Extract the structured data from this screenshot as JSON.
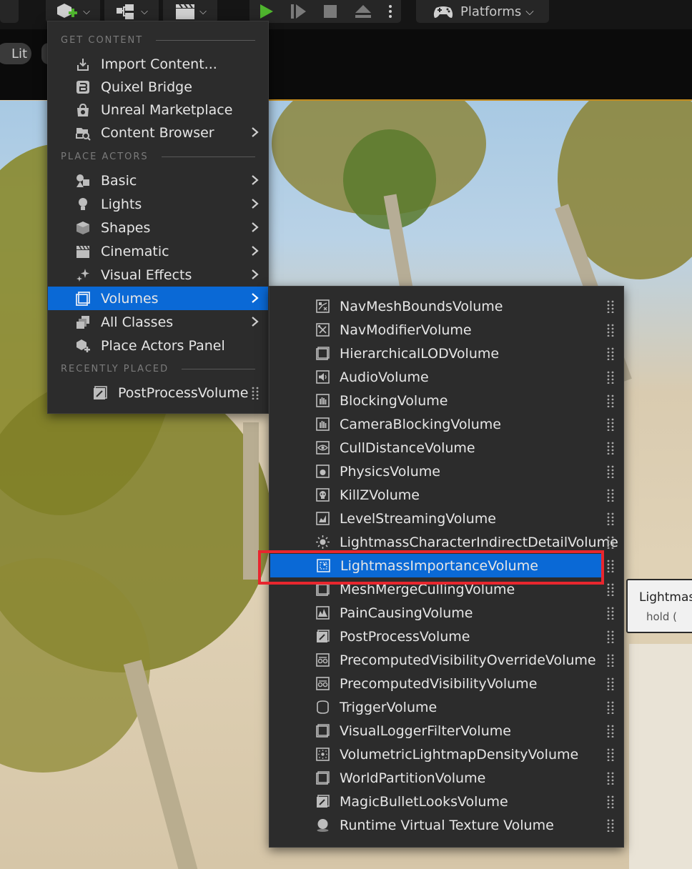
{
  "toolbar": {
    "platforms_label": "Platforms"
  },
  "viewport": {
    "lit_label": "Lit"
  },
  "menu": {
    "sections": {
      "get_content": "GET CONTENT",
      "place_actors": "PLACE ACTORS",
      "recently_placed": "RECENTLY PLACED"
    },
    "get_content_items": [
      {
        "label": "Import Content...",
        "icon": "import-icon",
        "submenu": false
      },
      {
        "label": "Quixel Bridge",
        "icon": "bridge-icon",
        "submenu": false
      },
      {
        "label": "Unreal Marketplace",
        "icon": "marketplace-icon",
        "submenu": false
      },
      {
        "label": "Content Browser",
        "icon": "content-browser-icon",
        "submenu": true
      }
    ],
    "place_actors_items": [
      {
        "label": "Basic",
        "icon": "basic-icon",
        "submenu": true
      },
      {
        "label": "Lights",
        "icon": "lightbulb-icon",
        "submenu": true
      },
      {
        "label": "Shapes",
        "icon": "cube-icon",
        "submenu": true
      },
      {
        "label": "Cinematic",
        "icon": "clapperboard-icon",
        "submenu": true
      },
      {
        "label": "Visual Effects",
        "icon": "sparkles-icon",
        "submenu": true
      },
      {
        "label": "Volumes",
        "icon": "volume-icon",
        "submenu": true,
        "active": true
      },
      {
        "label": "All Classes",
        "icon": "classes-icon",
        "submenu": true
      },
      {
        "label": "Place Actors Panel",
        "icon": "place-actors-icon",
        "submenu": false
      }
    ],
    "recently_placed": [
      {
        "label": "PostProcessVolume",
        "icon": "postprocess-icon"
      }
    ]
  },
  "volumes": [
    {
      "label": "NavMeshBoundsVolume",
      "icon": "navmesh-icon"
    },
    {
      "label": "NavModifierVolume",
      "icon": "navmodifier-icon"
    },
    {
      "label": "HierarchicalLODVolume",
      "icon": "box-volume-icon"
    },
    {
      "label": "AudioVolume",
      "icon": "speaker-icon"
    },
    {
      "label": "BlockingVolume",
      "icon": "hand-icon"
    },
    {
      "label": "CameraBlockingVolume",
      "icon": "camera-hand-icon"
    },
    {
      "label": "CullDistanceVolume",
      "icon": "eye-icon"
    },
    {
      "label": "PhysicsVolume",
      "icon": "physics-icon"
    },
    {
      "label": "KillZVolume",
      "icon": "skull-icon"
    },
    {
      "label": "LevelStreamingVolume",
      "icon": "chart-icon"
    },
    {
      "label": "LightmassCharacterIndirectDetailVolume",
      "icon": "sun-icon"
    },
    {
      "label": "LightmassImportanceVolume",
      "icon": "lightmass-icon",
      "active": true
    },
    {
      "label": "MeshMergeCullingVolume",
      "icon": "box-volume-icon"
    },
    {
      "label": "PainCausingVolume",
      "icon": "pain-icon"
    },
    {
      "label": "PostProcessVolume",
      "icon": "postprocess-icon"
    },
    {
      "label": "PrecomputedVisibilityOverrideVolume",
      "icon": "glasses-icon"
    },
    {
      "label": "PrecomputedVisibilityVolume",
      "icon": "glasses-icon"
    },
    {
      "label": "TriggerVolume",
      "icon": "trigger-icon"
    },
    {
      "label": "VisualLoggerFilterVolume",
      "icon": "box-volume-icon"
    },
    {
      "label": "VolumetricLightmapDensityVolume",
      "icon": "density-icon"
    },
    {
      "label": "WorldPartitionVolume",
      "icon": "box-volume-icon"
    },
    {
      "label": "MagicBulletLooksVolume",
      "icon": "postprocess-icon"
    },
    {
      "label": "Runtime Virtual Texture Volume",
      "icon": "sphere-icon"
    }
  ],
  "tooltip": {
    "title": "Lightmas",
    "hint": "hold ("
  },
  "colors": {
    "menu_bg": "#2c2c2c",
    "active_blue": "#0a69d6",
    "highlight_red": "#e8262e",
    "text": "#e6e6e6",
    "section_text": "#7b7b7b"
  }
}
